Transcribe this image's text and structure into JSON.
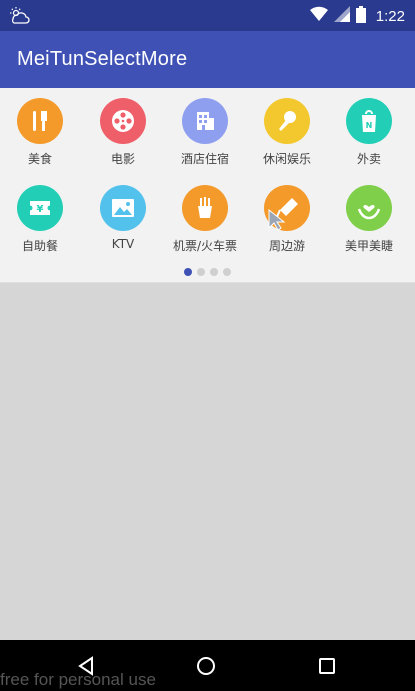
{
  "status_bar": {
    "time": "1:22",
    "icons": [
      "weather-icon",
      "wifi-icon",
      "signal-icon",
      "battery-icon"
    ]
  },
  "app_bar": {
    "title": "MeiTunSelectMore"
  },
  "grid": {
    "row1": [
      {
        "label": "美食",
        "icon": "fork-knife-icon",
        "color": "#f39a2b"
      },
      {
        "label": "电影",
        "icon": "film-reel-icon",
        "color": "#ef5f6a"
      },
      {
        "label": "酒店住宿",
        "icon": "building-icon",
        "color": "#8f9ff0"
      },
      {
        "label": "休闲娱乐",
        "icon": "microphone-icon",
        "color": "#f3c72e"
      },
      {
        "label": "外卖",
        "icon": "takeout-bag-icon",
        "color": "#22cfb6"
      }
    ],
    "row2": [
      {
        "label": "自助餐",
        "icon": "yen-ticket-icon",
        "color": "#22cfb6"
      },
      {
        "label": "KTV",
        "icon": "picture-icon",
        "color": "#52c1ec"
      },
      {
        "label": "机票/火车票",
        "icon": "fries-icon",
        "color": "#f39a2b"
      },
      {
        "label": "周边游",
        "icon": "kite-icon",
        "color": "#f39a2b"
      },
      {
        "label": "美甲美睫",
        "icon": "hand-heart-icon",
        "color": "#7fcf4a"
      }
    ]
  },
  "pager": {
    "count": 4,
    "active": 0
  },
  "watermark": "free for personal use"
}
